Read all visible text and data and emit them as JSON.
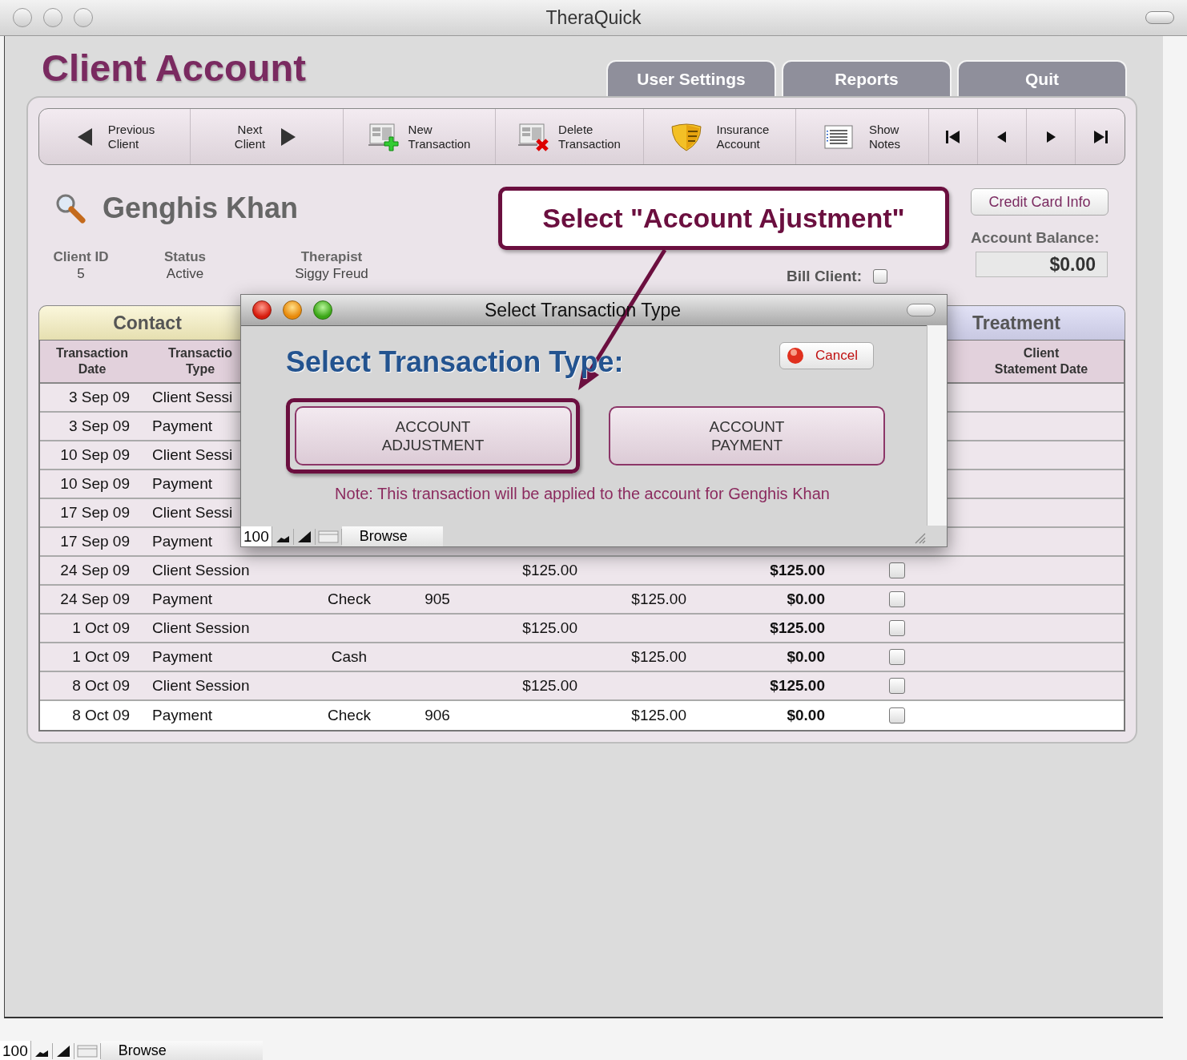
{
  "window": {
    "title": "TheraQuick"
  },
  "page_title": "Client Account",
  "top_tabs": [
    {
      "label": "User Settings"
    },
    {
      "label": "Reports"
    },
    {
      "label": "Quit"
    }
  ],
  "toolbar": [
    {
      "kind": "previous",
      "label": "Previous\nClient"
    },
    {
      "kind": "next",
      "label": "Next\nClient"
    },
    {
      "kind": "new",
      "label": "New\nTransaction"
    },
    {
      "kind": "delete",
      "label": "Delete\nTransaction"
    },
    {
      "kind": "insurance",
      "label": "Insurance\nAccount"
    },
    {
      "kind": "notes",
      "label": "Show\nNotes"
    }
  ],
  "record_nav": [
    {
      "kind": "first"
    },
    {
      "kind": "prev"
    },
    {
      "kind": "next"
    },
    {
      "kind": "last"
    }
  ],
  "client": {
    "name": "Genghis Khan",
    "fields": [
      {
        "label": "Client ID",
        "value": "5"
      },
      {
        "label": "Status",
        "value": "Active"
      },
      {
        "label": "Therapist",
        "value": "Siggy Freud"
      }
    ]
  },
  "credit_card_button": "Credit Card Info",
  "bill_client": {
    "label": "Bill Client:",
    "checked": false
  },
  "balance": {
    "label": "Account Balance:",
    "value": "$0.00"
  },
  "section_tabs": [
    {
      "label": "Contact",
      "selected": true
    },
    {
      "label": "Treatment",
      "selected": false
    }
  ],
  "table": {
    "columns": [
      {
        "kind": "date",
        "label": "Transaction\nDate"
      },
      {
        "kind": "type",
        "label": "Transactio\nType"
      },
      {
        "kind": "statement",
        "label": "Client\nStatement Date"
      }
    ],
    "rows": [
      {
        "date": "3 Sep 09",
        "type": "Client Sessi",
        "selected": false
      },
      {
        "date": "3 Sep 09",
        "type": "Payment",
        "selected": false
      },
      {
        "date": "10 Sep 09",
        "type": "Client Sessi",
        "selected": false
      },
      {
        "date": "10 Sep 09",
        "type": "Payment",
        "selected": false
      },
      {
        "date": "17 Sep 09",
        "type": "Client Sessi",
        "selected": false
      },
      {
        "date": "17 Sep 09",
        "type": "Payment",
        "selected": false
      },
      {
        "date": "24 Sep 09",
        "type": "Client Session",
        "charge": "$125.00",
        "balance": "$125.00",
        "billed": false,
        "selected": false
      },
      {
        "date": "24 Sep 09",
        "type": "Payment",
        "method": "Check",
        "number": "905",
        "payment": "$125.00",
        "balance": "$0.00",
        "billed": false,
        "selected": false
      },
      {
        "date": "1 Oct 09",
        "type": "Client Session",
        "charge": "$125.00",
        "balance": "$125.00",
        "billed": false,
        "selected": false
      },
      {
        "date": "1 Oct 09",
        "type": "Payment",
        "method": "Cash",
        "payment": "$125.00",
        "balance": "$0.00",
        "billed": false,
        "selected": false
      },
      {
        "date": "8 Oct 09",
        "type": "Client Session",
        "charge": "$125.00",
        "balance": "$125.00",
        "billed": false,
        "selected": false
      },
      {
        "date": "8 Oct 09",
        "type": "Payment",
        "method": "Check",
        "number": "906",
        "payment": "$125.00",
        "balance": "$0.00",
        "billed": false,
        "selected": true
      }
    ]
  },
  "dialog": {
    "title": "Select Transaction Type",
    "heading": "Select Transaction Type:",
    "cancel": "Cancel",
    "options": [
      {
        "label": "ACCOUNT\nADJUSTMENT",
        "highlighted": true
      },
      {
        "label": "ACCOUNT\nPAYMENT",
        "highlighted": false
      }
    ],
    "note": "Note: This transaction will be applied to the account for Genghis Khan",
    "status_bar": {
      "zoom": "100",
      "mode": "Browse"
    }
  },
  "callout": {
    "text": "Select \"Account Ajustment\""
  },
  "status_bar": {
    "zoom": "100",
    "mode": "Browse"
  }
}
